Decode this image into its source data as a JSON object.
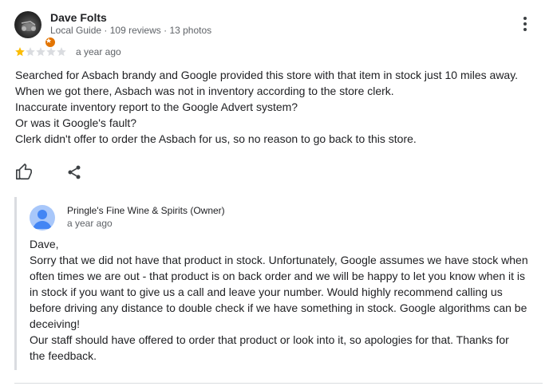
{
  "reviewer": {
    "name": "Dave Folts",
    "meta": [
      "Local Guide",
      "109 reviews",
      "13 photos"
    ],
    "avatar_icon": "profile-photo",
    "badge_icon": "local-guide-star-icon"
  },
  "review": {
    "rating": 1,
    "max_rating": 5,
    "time": "a year ago",
    "lines": [
      "Searched for Asbach brandy and Google provided this store with that item in stock just 10 miles away.",
      "When we got there, Asbach was not in inventory according to the store clerk.",
      "Inaccurate inventory report to the Google Advert system?",
      "Or was it Google's fault?",
      "Clerk didn't offer to order the Asbach for us, so no reason to go back to this store."
    ]
  },
  "actions": {
    "like_icon": "thumbs-up-icon",
    "share_icon": "share-icon",
    "more_icon": "more-vert-icon"
  },
  "owner_response": {
    "name": "Pringle's Fine Wine & Spirits (Owner)",
    "time": "a year ago",
    "lines": [
      "Dave,",
      "Sorry that we did not have that product in stock. Unfortunately, Google assumes we have stock when",
      "often times we are out - that product is on back order and we will be happy to let you know when it is",
      "in stock if you want to give us a call and leave your number. Would highly recommend calling us",
      "before driving any distance to double check if we have something in stock. Google algorithms can be",
      "deceiving!",
      "Our staff should have offered to order that product or look into it, so apologies for that. Thanks for",
      "the feedback."
    ]
  },
  "colors": {
    "star_filled": "#fbbc04",
    "star_empty": "#dadce0",
    "muted_text": "#5f6368",
    "owner_avatar": "#a8c7fa",
    "badge": "#e37400"
  }
}
